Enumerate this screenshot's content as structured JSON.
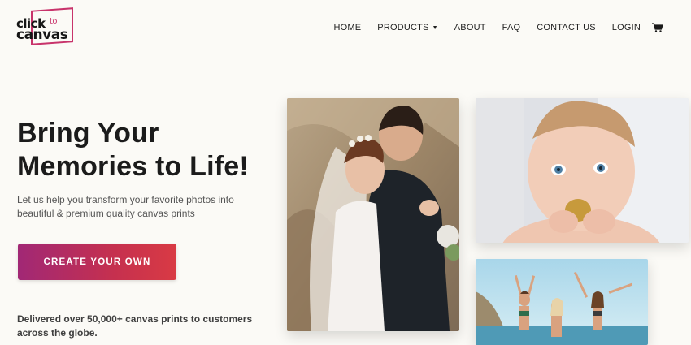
{
  "brand": {
    "logo_top": "click",
    "logo_small": "to",
    "logo_bottom": "canvas"
  },
  "nav": {
    "items": [
      {
        "label": "HOME"
      },
      {
        "label": "PRODUCTS",
        "has_dropdown": true
      },
      {
        "label": "ABOUT"
      },
      {
        "label": "FAQ"
      },
      {
        "label": "CONTACT US"
      },
      {
        "label": "LOGIN"
      }
    ],
    "cart_icon": "shopping-cart-icon"
  },
  "hero": {
    "headline_line1": "Bring Your",
    "headline_line2": "Memories to Life!",
    "subtext_line1": "Let us help you transform your favorite photos into",
    "subtext_line2": "beautiful & premium quality canvas prints",
    "cta_label": "CREATE YOUR OWN",
    "delivered_line1": "Delivered over 50,000+ canvas prints to customers",
    "delivered_line2": "across the globe."
  },
  "colors": {
    "brand_accent": "#c8336b",
    "cta_gradient_start": "#a12875",
    "cta_gradient_end": "#d93a44",
    "background": "#fbfaf6"
  }
}
